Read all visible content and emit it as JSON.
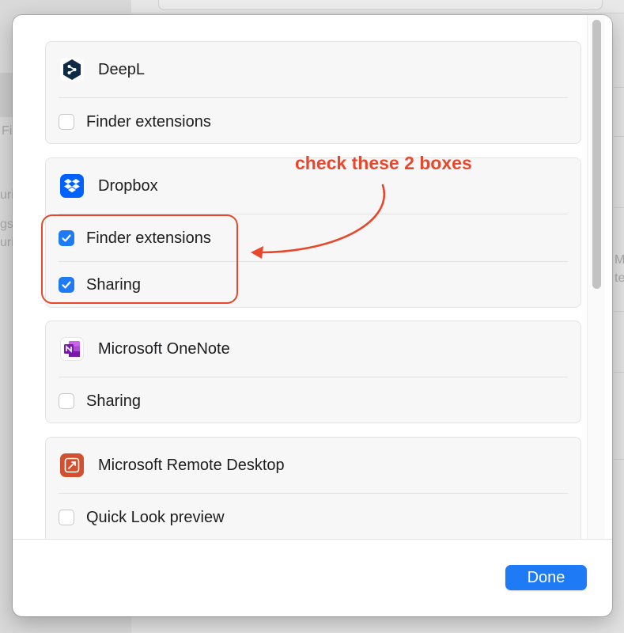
{
  "background": {
    "fragments": [
      "Fi",
      "urit",
      "gs",
      "urit",
      "M",
      "te"
    ]
  },
  "groups": [
    {
      "app": "DeepL",
      "icon": "deepl-icon",
      "options": [
        {
          "label": "Finder extensions",
          "checked": false
        }
      ]
    },
    {
      "app": "Dropbox",
      "icon": "dropbox-icon",
      "options": [
        {
          "label": "Finder extensions",
          "checked": true
        },
        {
          "label": "Sharing",
          "checked": true
        }
      ]
    },
    {
      "app": "Microsoft OneNote",
      "icon": "onenote-icon",
      "options": [
        {
          "label": "Sharing",
          "checked": false
        }
      ]
    },
    {
      "app": "Microsoft Remote Desktop",
      "icon": "remote-desktop-icon",
      "options": [
        {
          "label": "Quick Look preview",
          "checked": false
        }
      ]
    }
  ],
  "footer": {
    "done_label": "Done"
  },
  "annotation": {
    "text": "check these 2 boxes"
  },
  "colors": {
    "accent": "#1f7bf5",
    "annotation": "#e8472b",
    "deepl": "#0f2b46",
    "dropbox": "#0061fe",
    "onenote": "#7719aa",
    "remote_desktop": "#d0502f"
  }
}
